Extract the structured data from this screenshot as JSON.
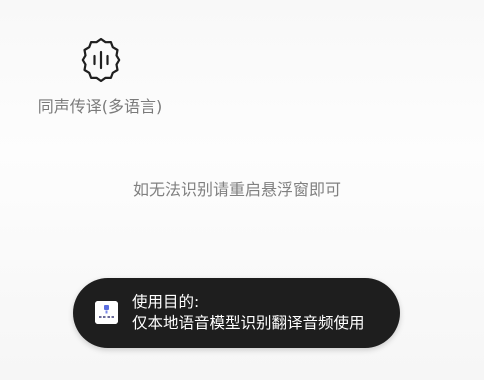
{
  "feature": {
    "icon": "voice-waveform-badge-icon",
    "label": "同声传译(多语言)"
  },
  "hint": "如无法识别请重启悬浮窗即可",
  "toast": {
    "app_icon": "app-logo-icon",
    "title": "使用目的:",
    "message": "仅本地语音模型识别翻译音频使用"
  },
  "colors": {
    "toast_background": "#1e1e1e",
    "toast_text": "#ffffff",
    "label_text": "#7a7a7a",
    "hint_text": "#808080",
    "icon_stroke": "#1f1f1f"
  }
}
